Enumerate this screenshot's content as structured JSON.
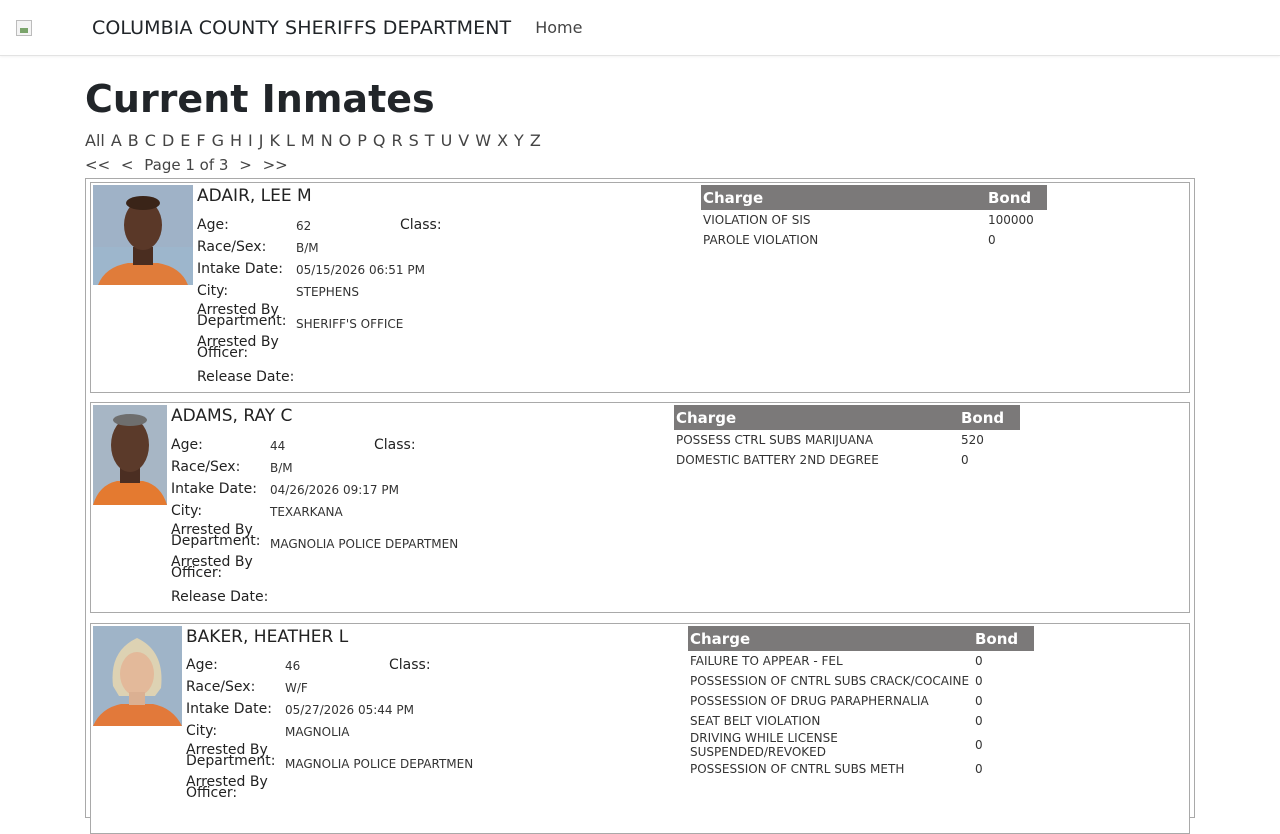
{
  "nav": {
    "brand": "COLUMBIA COUNTY SHERIFFS DEPARTMENT",
    "home": "Home"
  },
  "page": {
    "title": "Current Inmates"
  },
  "letters": [
    "All",
    "A",
    "B",
    "C",
    "D",
    "E",
    "F",
    "G",
    "H",
    "I",
    "J",
    "K",
    "L",
    "M",
    "N",
    "O",
    "P",
    "Q",
    "R",
    "S",
    "T",
    "U",
    "V",
    "W",
    "X",
    "Y",
    "Z"
  ],
  "pager": {
    "first": "<<",
    "prev": "<",
    "label": "Page 1 of 3",
    "next": ">",
    "last": ">>"
  },
  "labels": {
    "age": "Age:",
    "class": "Class:",
    "race_sex": "Race/Sex:",
    "intake": "Intake Date:",
    "city": "City:",
    "arrested_by": "Arrested By",
    "department": "Department:",
    "officer": "Officer:",
    "release": "Release Date:",
    "charge": "Charge",
    "bond": "Bond"
  },
  "inmates": [
    {
      "name": "ADAIR, LEE M",
      "age": "62",
      "race_sex": "B/M",
      "intake": "05/15/2026 06:51 PM",
      "city": "STEPHENS",
      "department": "SHERIFF'S OFFICE",
      "charges": [
        {
          "charge": "VIOLATION OF SIS",
          "bond": "100000"
        },
        {
          "charge": "PAROLE VIOLATION",
          "bond": "0"
        }
      ]
    },
    {
      "name": "ADAMS, RAY C",
      "age": "44",
      "race_sex": "B/M",
      "intake": "04/26/2026 09:17 PM",
      "city": "TEXARKANA",
      "department": "MAGNOLIA POLICE DEPARTMEN",
      "charges": [
        {
          "charge": "POSSESS CTRL SUBS MARIJUANA",
          "bond": "520"
        },
        {
          "charge": "DOMESTIC BATTERY 2ND DEGREE",
          "bond": "0"
        }
      ]
    },
    {
      "name": "BAKER, HEATHER L",
      "age": "46",
      "race_sex": "W/F",
      "intake": "05/27/2026 05:44 PM",
      "city": "MAGNOLIA",
      "department": "MAGNOLIA POLICE DEPARTMEN",
      "charges": [
        {
          "charge": "FAILURE TO APPEAR - FEL",
          "bond": "0"
        },
        {
          "charge": "POSSESSION OF CNTRL SUBS CRACK/COCAINE",
          "bond": "0"
        },
        {
          "charge": "POSSESSION OF DRUG PARAPHERNALIA",
          "bond": "0"
        },
        {
          "charge": "SEAT BELT VIOLATION",
          "bond": "0"
        },
        {
          "charge": "DRIVING WHILE LICENSE SUSPENDED/REVOKED",
          "bond": "0"
        },
        {
          "charge": "POSSESSION OF CNTRL SUBS METH",
          "bond": "0"
        }
      ]
    }
  ]
}
